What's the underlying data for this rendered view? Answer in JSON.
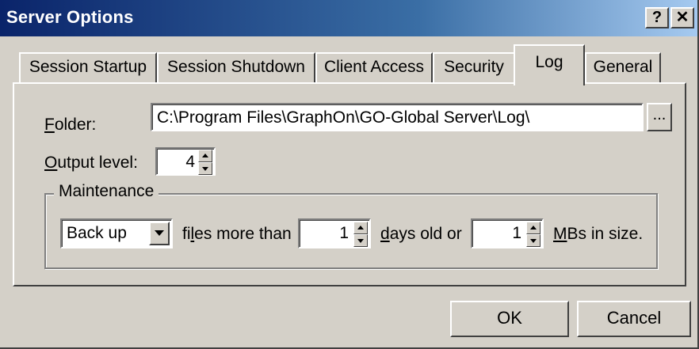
{
  "window": {
    "title": "Server Options",
    "help_label": "?",
    "close_label": "✕"
  },
  "tabs": [
    {
      "label": "Session Startup"
    },
    {
      "label": "Session Shutdown"
    },
    {
      "label": "Client Access"
    },
    {
      "label": "Security"
    },
    {
      "label": "Log"
    },
    {
      "label": "General"
    }
  ],
  "active_tab": "Log",
  "log": {
    "folder_label_u": "F",
    "folder_label_rest": "older:",
    "folder_value": "C:\\Program Files\\GraphOn\\GO-Global Server\\Log\\",
    "browse_label": "...",
    "output_label_u": "O",
    "output_label_rest": "utput level:",
    "output_value": "4"
  },
  "maintenance": {
    "group_label": "Maintenance",
    "action_value": "Back up",
    "files_pre": "fi",
    "files_u": "l",
    "files_post": "es more than",
    "days_value": "1",
    "days_u": "d",
    "days_post": "ays old or",
    "mb_value": "1",
    "mb_u": "M",
    "mb_post": "Bs in size."
  },
  "buttons": {
    "ok": "OK",
    "cancel": "Cancel"
  }
}
